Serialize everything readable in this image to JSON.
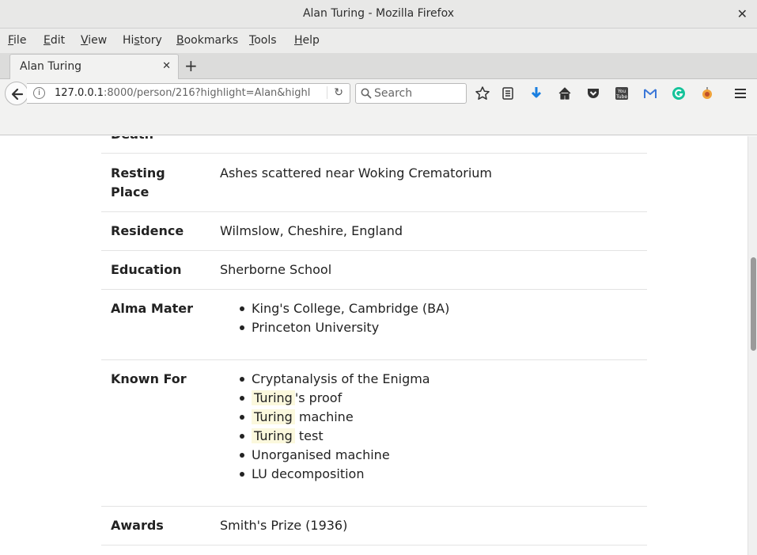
{
  "window": {
    "title": "Alan Turing - Mozilla Firefox",
    "close_glyph": "✕"
  },
  "menu": [
    {
      "label": "File",
      "accel": "F",
      "rest": "ile"
    },
    {
      "label": "Edit",
      "accel": "E",
      "rest": "dit"
    },
    {
      "label": "View",
      "accel": "V",
      "rest": "iew"
    },
    {
      "label": "History",
      "pre": "Hi",
      "accel": "s",
      "rest": "tory"
    },
    {
      "label": "Bookmarks",
      "accel": "B",
      "rest": "ookmarks"
    },
    {
      "label": "Tools",
      "accel": "T",
      "rest": "ools"
    },
    {
      "label": "Help",
      "accel": "H",
      "rest": "elp"
    }
  ],
  "tab": {
    "label": "Alan Turing",
    "close_glyph": "✕",
    "new_tab_glyph": "+"
  },
  "nav": {
    "url_host": "127.0.0.1",
    "url_rest": ":8000/person/216?highlight=Alan&highl",
    "search_placeholder": "Search",
    "toolbar_icons": [
      "bookmark-star-icon",
      "reading-list-icon",
      "download-icon",
      "home-icon",
      "pocket-icon",
      "youtube-icon",
      "gmail-icon",
      "grammarly-icon",
      "extension-icon",
      "hamburger-menu-icon"
    ]
  },
  "rows": {
    "death": {
      "label": "Death"
    },
    "resting": {
      "label1": "Resting",
      "label2": "Place",
      "value": "Ashes scattered near Woking Crematorium"
    },
    "residence": {
      "label": "Residence",
      "value": "Wilmslow, Cheshire, England"
    },
    "education": {
      "label": "Education",
      "value": "Sherborne School"
    },
    "alma": {
      "label": "Alma Mater",
      "items": [
        "King's College, Cambridge (BA)",
        "Princeton University"
      ]
    },
    "known": {
      "label": "Known For",
      "item1": "Cryptanalysis of the Enigma",
      "highlight": "Turing",
      "item2_suffix": "'s proof",
      "item3_suffix": " machine",
      "item4_suffix": " test",
      "item5": "Unorganised machine",
      "item6": "LU decomposition"
    },
    "awards": {
      "label": "Awards",
      "value": "Smith's Prize (1936)"
    }
  },
  "colors": {
    "highlight": "#fbf8dd",
    "download_icon": "#1a7fe0",
    "grammarly_icon": "#15c39a",
    "gmail_icon": "#3c78d8"
  }
}
